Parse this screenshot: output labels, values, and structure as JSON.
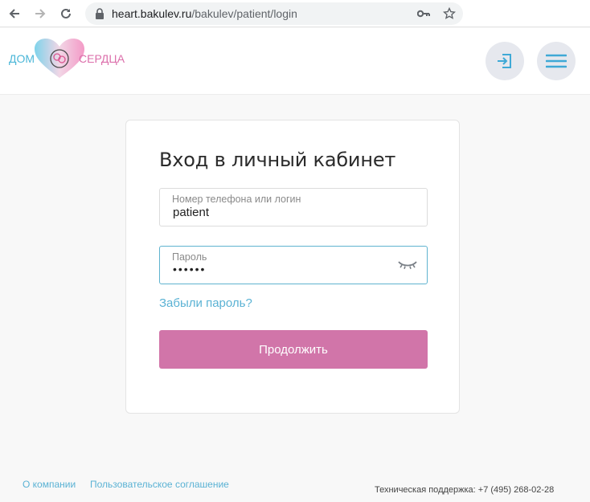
{
  "browser": {
    "url_host": "heart.bakulev.ru",
    "url_path": "/bakulev/patient/login"
  },
  "header": {
    "logo_left": "ДОМ",
    "logo_right": "СЕРДЦА",
    "login_icon": "login-icon",
    "menu_icon": "hamburger-menu-icon"
  },
  "login": {
    "title": "Вход в личный кабинет",
    "login_label": "Номер телефона или логин",
    "login_value": "patient",
    "password_label": "Пароль",
    "password_value": "••••••",
    "forgot_label": "Забыли пароль?",
    "submit_label": "Продолжить"
  },
  "footer": {
    "about": "О компании",
    "agreement": "Пользовательское соглашение",
    "support": "Техническая поддержка: +7 (495) 268-02-28"
  },
  "colors": {
    "accent_pink": "#d175a9",
    "accent_blue": "#5ab2d4"
  }
}
